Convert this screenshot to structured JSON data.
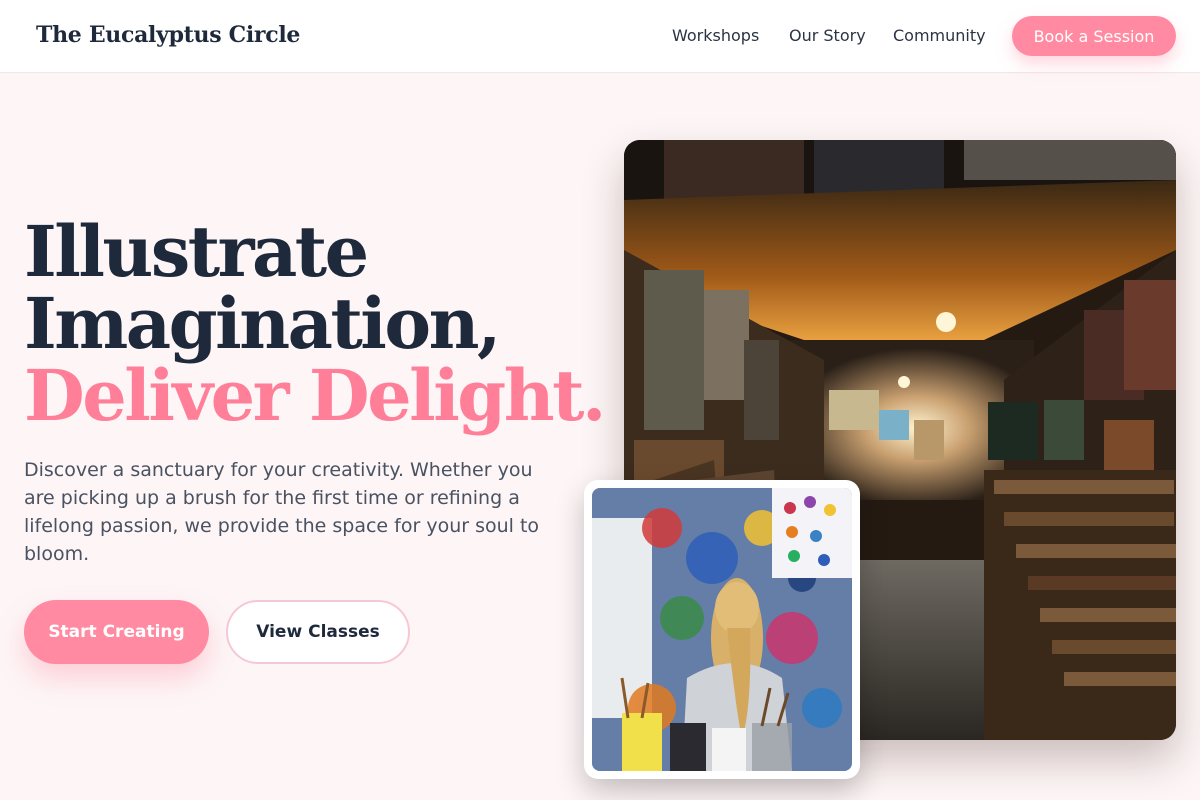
{
  "header": {
    "brand": "The Eucalyptus Circle",
    "nav": {
      "workshops": "Workshops",
      "our_story": "Our Story",
      "community": "Community"
    },
    "cta": "Book a Session"
  },
  "hero": {
    "headline_line1": "Illustrate",
    "headline_line2": "Imagination,",
    "headline_line3": "Deliver Delight.",
    "lead": "Discover a sanctuary for your creativity. Whether you are picking up a brush for the first time or refining a lifelong passion, we provide the space for your soul to bloom.",
    "primary_button": "Start Creating",
    "secondary_button": "View Classes"
  },
  "colors": {
    "accent": "#ff8aa1",
    "accent_text": "#ff7f98",
    "heading": "#1e2a3b",
    "background": "#fdf5f6"
  },
  "images": {
    "main": "art-gallery-storage-room-photo",
    "inset": "child-painting-at-easel-photo"
  }
}
